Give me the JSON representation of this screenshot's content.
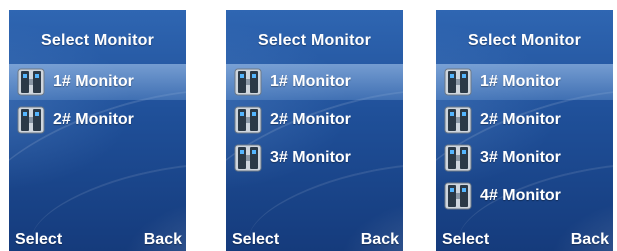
{
  "colors": {
    "screen_top": "#2f66b2",
    "screen_bottom": "#153b7c",
    "text": "#ffffff",
    "selection": "#a9c8ee"
  },
  "screens": [
    {
      "title": "Select Monitor",
      "items": [
        {
          "label": "1# Monitor",
          "icon": "door-monitor-icon",
          "selected": true
        },
        {
          "label": "2# Monitor",
          "icon": "door-monitor-icon"
        }
      ],
      "left_softkey": "Select",
      "right_softkey": "Back"
    },
    {
      "title": "Select Monitor",
      "items": [
        {
          "label": "1# Monitor",
          "icon": "door-monitor-icon",
          "selected": true
        },
        {
          "label": "2# Monitor",
          "icon": "door-monitor-icon"
        },
        {
          "label": "3# Monitor",
          "icon": "door-monitor-icon"
        }
      ],
      "left_softkey": "Select",
      "right_softkey": "Back"
    },
    {
      "title": "Select Monitor",
      "items": [
        {
          "label": "1# Monitor",
          "icon": "door-monitor-icon",
          "selected": true
        },
        {
          "label": "2# Monitor",
          "icon": "door-monitor-icon"
        },
        {
          "label": "3# Monitor",
          "icon": "door-monitor-icon"
        },
        {
          "label": "4# Monitor",
          "icon": "door-monitor-icon"
        }
      ],
      "left_softkey": "Select",
      "right_softkey": "Back"
    }
  ]
}
